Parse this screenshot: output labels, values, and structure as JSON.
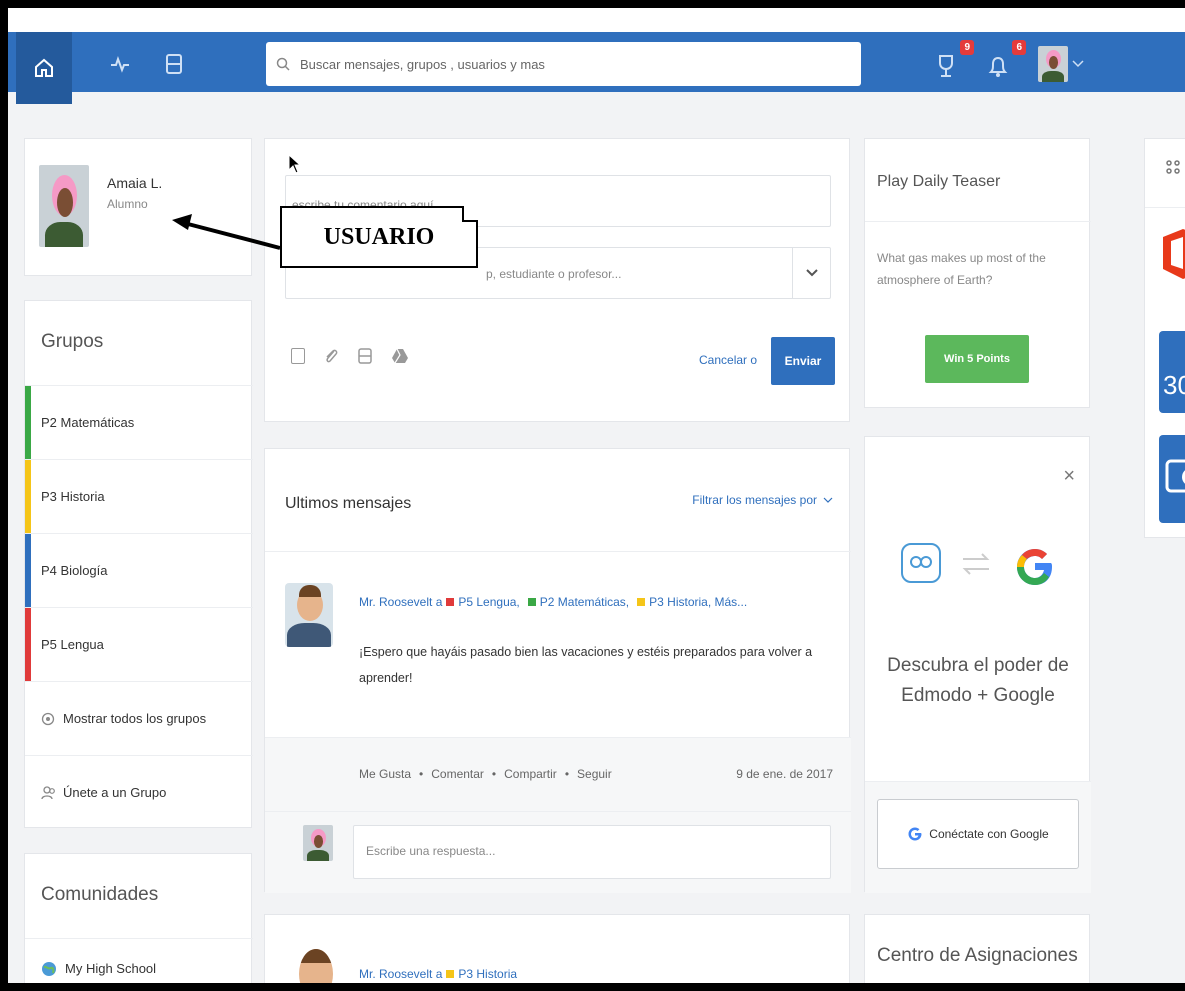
{
  "topbar": {
    "search_placeholder": "Buscar mensajes, grupos , usuarios y mas",
    "trophy_badge": "9",
    "bell_badge": "6"
  },
  "profile": {
    "name": "Amaia L.",
    "role": "Alumno"
  },
  "groups": {
    "title": "Grupos",
    "items": [
      {
        "label": "P2 Matemáticas",
        "color": "#3aa845"
      },
      {
        "label": "P3 Historia",
        "color": "#f5c518"
      },
      {
        "label": "P4 Biología",
        "color": "#2f6fbd"
      },
      {
        "label": "P5 Lengua",
        "color": "#e03a3a"
      }
    ],
    "show_all": "Mostrar todos los grupos",
    "join": "Únete a un Grupo"
  },
  "communities": {
    "title": "Comunidades",
    "items": [
      "My High School"
    ]
  },
  "composer": {
    "comment_placeholder": "escribe tu comentario aquí...",
    "recipient_placeholder": "p, estudiante o profesor...",
    "cancel": "Cancelar o",
    "send": "Enviar"
  },
  "feed": {
    "title": "Ultimos mensajes",
    "filter": "Filtrar los mensajes por",
    "post1": {
      "author": "Mr. Roosevelt a",
      "groups": [
        {
          "label": "P5 Lengua,",
          "color": "#e03a3a"
        },
        {
          "label": "P2 Matemáticas,",
          "color": "#3aa845"
        },
        {
          "label": "P3 Historia, Más...",
          "color": "#f5c518"
        }
      ],
      "text": "¡Espero que hayáis pasado bien las vacaciones y estéis preparados para volver a aprender!",
      "actions": [
        "Me Gusta",
        "Comentar",
        "Compartir",
        "Seguir"
      ],
      "date": "9 de ene. de 2017",
      "reply_placeholder": "Escribe una respuesta..."
    },
    "post2": {
      "author": "Mr. Roosevelt a",
      "group": "P3 Historia",
      "group_color": "#f5c518"
    }
  },
  "teaser": {
    "title": "Play Daily Teaser",
    "question": "What gas makes up most of the atmosphere of Earth?",
    "button": "Win 5 Points"
  },
  "google": {
    "close": "×",
    "text": "Descubra el poder de Edmodo + Google",
    "button": "Conéctate con Google"
  },
  "assignments": {
    "title": "Centro de Asignaciones"
  },
  "apps": {
    "calendar_label": "30"
  },
  "annotation": {
    "label": "USUARIO"
  }
}
